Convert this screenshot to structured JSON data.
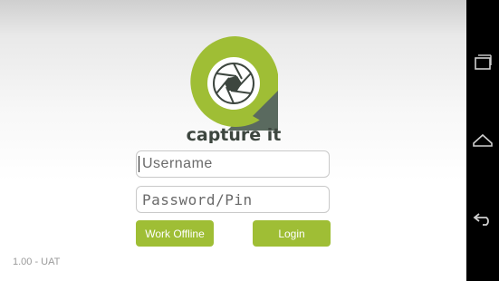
{
  "brand": {
    "name": "capture it"
  },
  "login": {
    "username_placeholder": "Username",
    "password_placeholder": "Password/Pin",
    "offline_label": "Work Offline",
    "login_label": "Login"
  },
  "footer": {
    "version": "1.00 - UAT"
  },
  "icons": {
    "logo": "capture-it-logo",
    "recents": "recent-apps-icon",
    "home": "home-icon",
    "back": "back-icon"
  },
  "colors": {
    "accent": "#9fbe35",
    "shadow": "#5a6a5f",
    "navbar": "#000000"
  }
}
